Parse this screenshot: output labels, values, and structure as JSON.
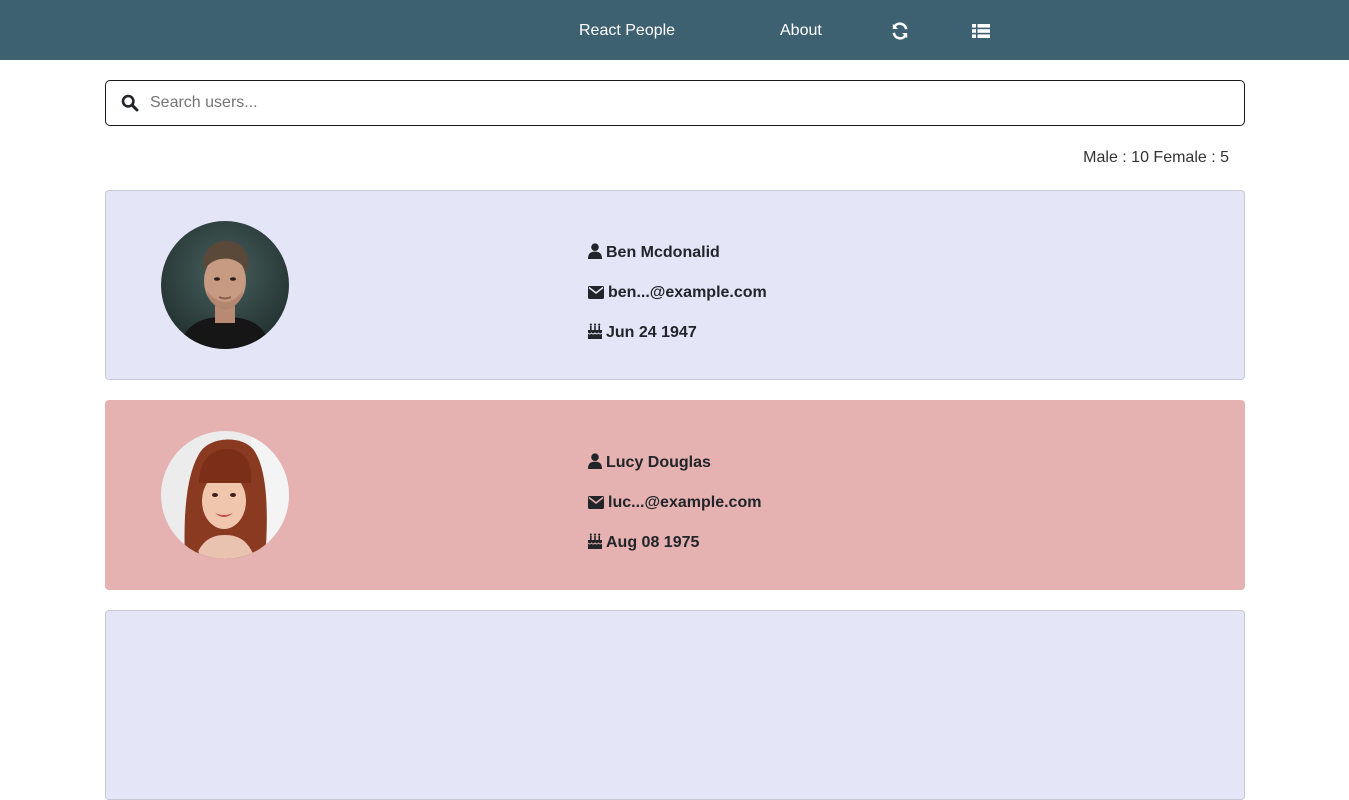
{
  "nav": {
    "brand": "React People",
    "about": "About",
    "refresh_icon": "refresh-icon",
    "list_icon": "list-icon",
    "background": "#3e6172"
  },
  "search": {
    "placeholder": "Search users...",
    "value": "",
    "icon": "search-icon"
  },
  "stats": {
    "text": "Male : 10 Female : 5",
    "male": 10,
    "female": 5
  },
  "users": [
    {
      "name": "Ben Mcdonalid",
      "email": "ben...@example.com",
      "dob": "Jun 24 1947",
      "gender": "male",
      "card_color": "#e5e5f8"
    },
    {
      "name": "Lucy Douglas",
      "email": "luc...@example.com",
      "dob": "Aug 08 1975",
      "gender": "female",
      "card_color": "#e5b1b1"
    }
  ]
}
